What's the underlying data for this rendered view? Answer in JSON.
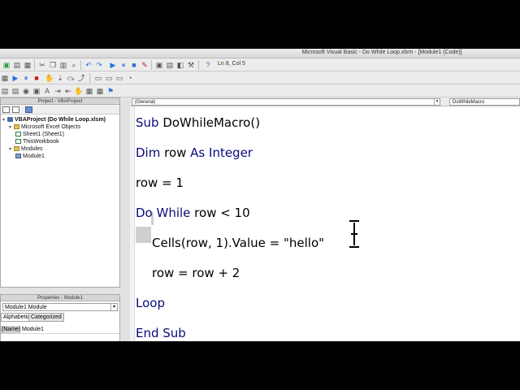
{
  "window": {
    "title": "Microsoft Visual Basic - Do While Loop.xlsm - [Module1 (Code)]",
    "status": "Ln 8, Col 5"
  },
  "project_pane": {
    "title": "Project - VBAProject",
    "tree": [
      {
        "label": "VBAProject (Do While Loop.xlsm)",
        "level": 0,
        "icon": "vba-project-icon",
        "bold": true
      },
      {
        "label": "Microsoft Excel Objects",
        "level": 1,
        "icon": "folder-icon"
      },
      {
        "label": "Sheet1 (Sheet1)",
        "level": 2,
        "icon": "sheet-icon"
      },
      {
        "label": "ThisWorkbook",
        "level": 2,
        "icon": "workbook-icon"
      },
      {
        "label": "Modules",
        "level": 1,
        "icon": "folder-icon"
      },
      {
        "label": "Module1",
        "level": 2,
        "icon": "module-icon"
      }
    ]
  },
  "properties_pane": {
    "title": "Properties - Module1",
    "object_select": "Module1 Module",
    "tabs": [
      "Alphabetic",
      "Categorized"
    ],
    "rows": [
      {
        "key": "(Name)",
        "value": "Module1"
      }
    ]
  },
  "code_pane": {
    "object_combo": "(General)",
    "procedure_combo": "DoWhileMacro",
    "lines": [
      {
        "kw": "Sub",
        "rest": " DoWhileMacro()",
        "indent": false
      },
      {
        "kw": "Dim",
        "rest": " row ",
        "kw2": "As Integer",
        "indent": false
      },
      {
        "kw": "",
        "rest": "row = 1",
        "indent": false
      },
      {
        "kw": "Do While",
        "rest": " row < 10",
        "indent": false
      },
      {
        "kw": "",
        "rest": "Cells(row, 1).Value = \"hello\"",
        "indent": true
      },
      {
        "kw": "",
        "rest": "row = row + 2",
        "indent": true
      },
      {
        "kw": "Loop",
        "rest": "",
        "indent": false
      },
      {
        "kw": "End Sub",
        "rest": "",
        "indent": false
      }
    ]
  }
}
